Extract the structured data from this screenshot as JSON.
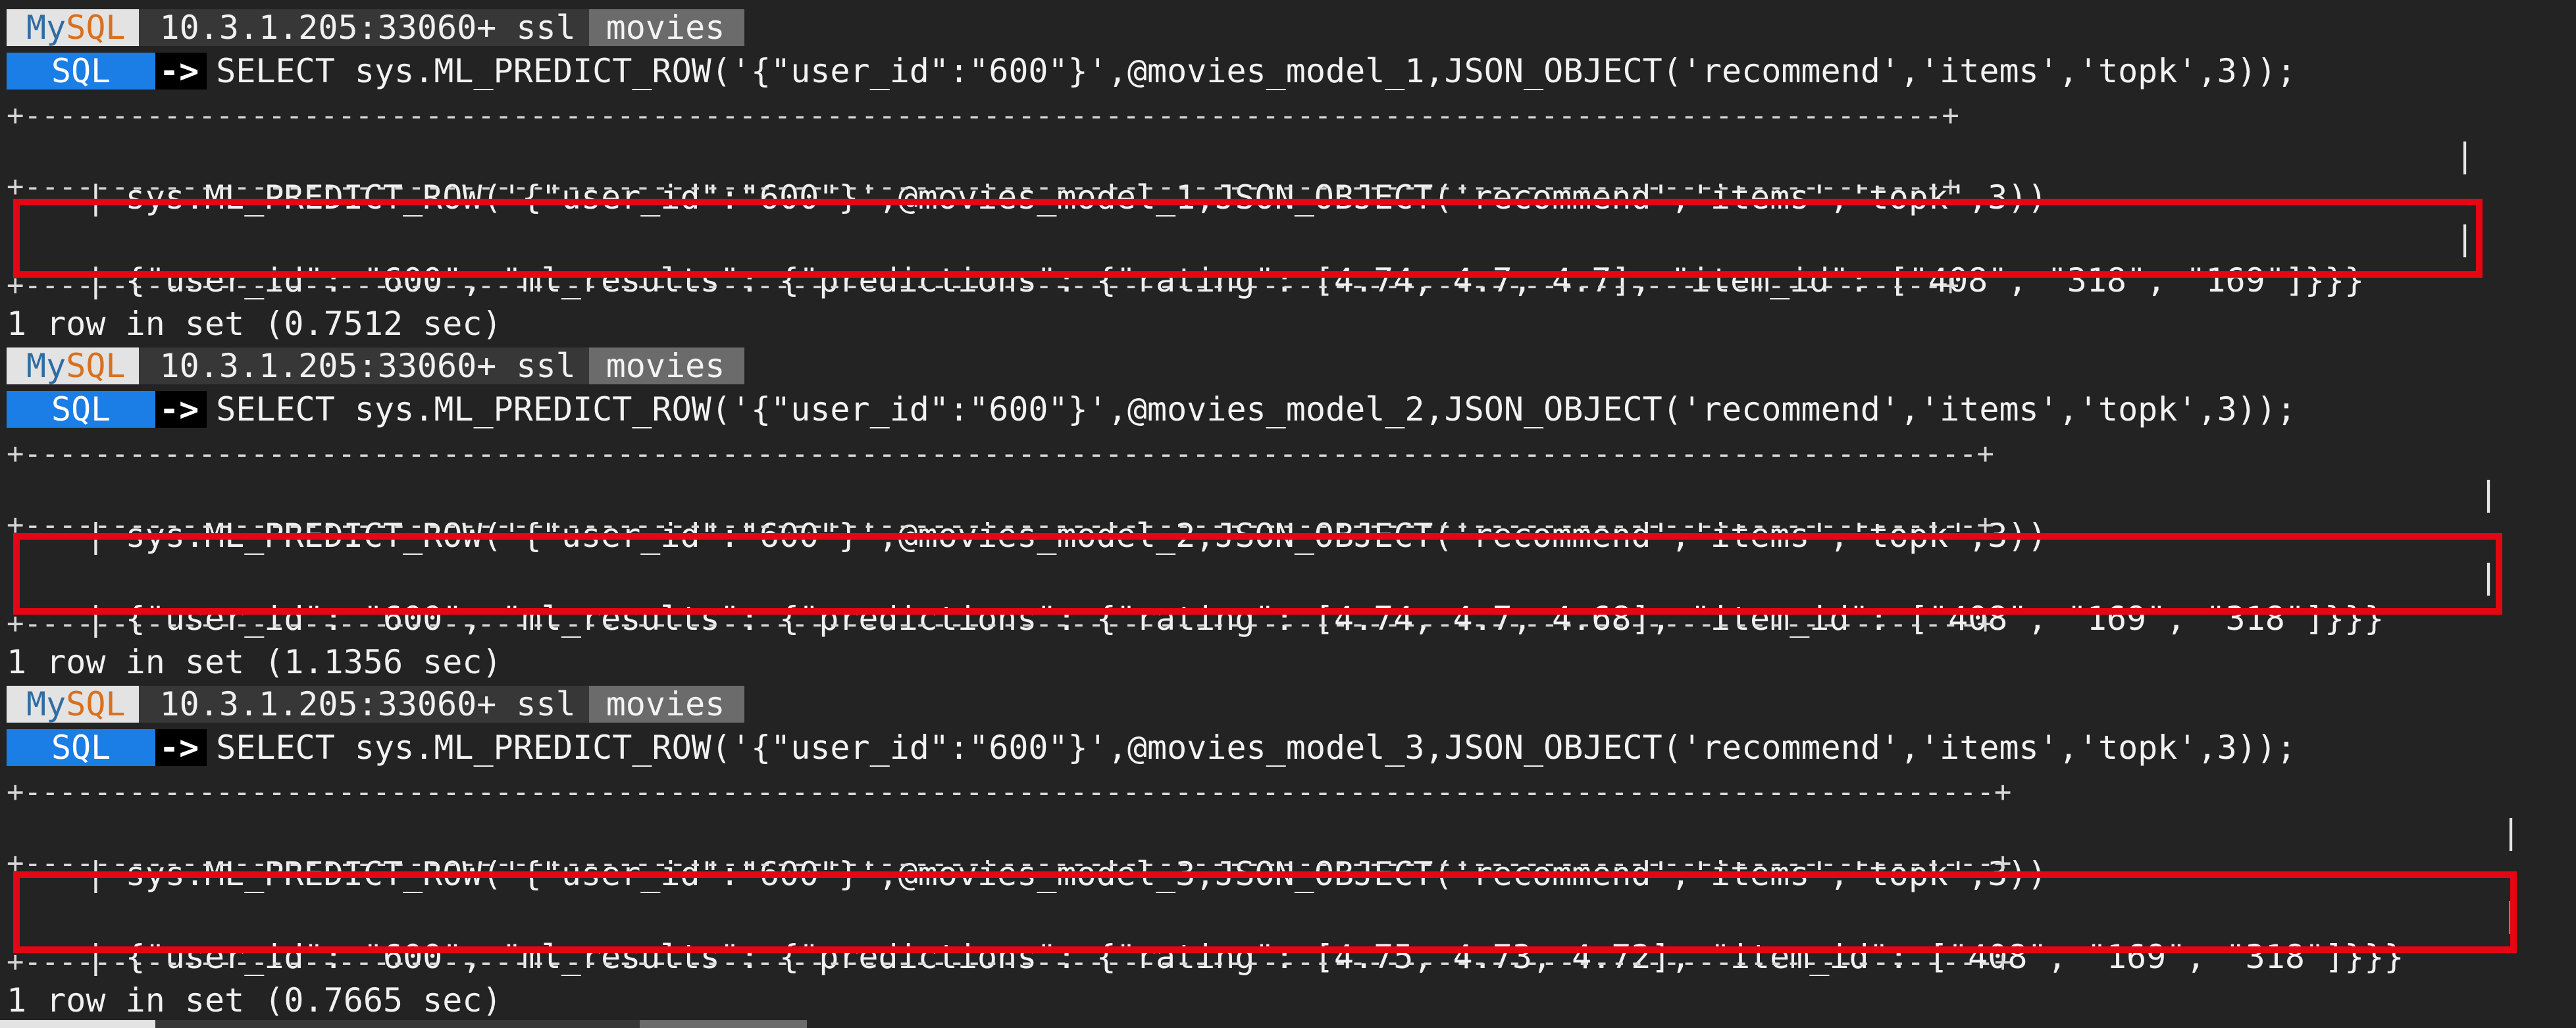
{
  "prompt": {
    "app_my": "My",
    "app_sql": "SQL",
    "host": "10.3.1.205:33060+ ssl",
    "database": "movies",
    "mode": "SQL",
    "arrow": "->"
  },
  "blocks": [
    {
      "command": "SELECT sys.ML_PREDICT_ROW('{\"user_id\":\"600\"}',@movies_model_1,JSON_OBJECT('recommend','items','topk',3));",
      "header": "sys.ML_PREDICT_ROW('{\"user_id\":\"600\"}',@movies_model_1,JSON_OBJECT('recommend','items','topk',3))",
      "result": "{\"user_id\": \"600\", \"ml_results\": {\"predictions\": {\"rating\": [4.74, 4.7, 4.7], \"item_id\": [\"408\", \"318\", \"169\"]}}}",
      "status": "1 row in set (0.7512 sec)"
    },
    {
      "command": "SELECT sys.ML_PREDICT_ROW('{\"user_id\":\"600\"}',@movies_model_2,JSON_OBJECT('recommend','items','topk',3));",
      "header": "sys.ML_PREDICT_ROW('{\"user_id\":\"600\"}',@movies_model_2,JSON_OBJECT('recommend','items','topk',3))",
      "result": "{\"user_id\": \"600\", \"ml_results\": {\"predictions\": {\"rating\": [4.74, 4.7, 4.68], \"item_id\": [\"408\", \"169\", \"318\"]}}}",
      "status": "1 row in set (1.1356 sec)"
    },
    {
      "command": "SELECT sys.ML_PREDICT_ROW('{\"user_id\":\"600\"}',@movies_model_3,JSON_OBJECT('recommend','items','topk',3));",
      "header": "sys.ML_PREDICT_ROW('{\"user_id\":\"600\"}',@movies_model_3,JSON_OBJECT('recommend','items','topk',3))",
      "result": "{\"user_id\": \"600\", \"ml_results\": {\"predictions\": {\"rating\": [4.75, 4.73, 4.72], \"item_id\": [\"408\", \"169\", \"318\"]}}}",
      "status": "1 row in set (0.7665 sec)"
    }
  ],
  "colors": {
    "background": "#232323",
    "mode_badge": "#1b7de6",
    "highlight": "#e30613",
    "mysql_my": "#2f6da3",
    "mysql_sql": "#d8701f"
  }
}
